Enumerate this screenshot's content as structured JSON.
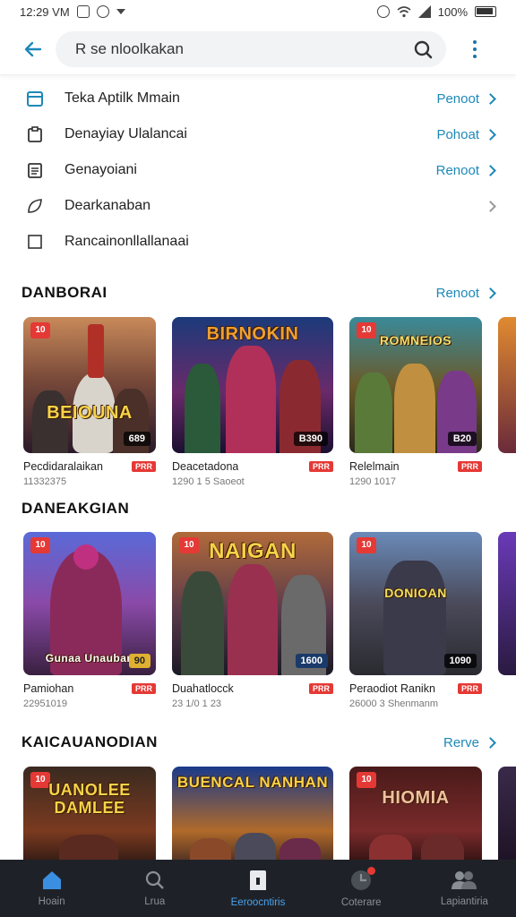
{
  "status": {
    "time": "12:29 VM",
    "battery": "100%"
  },
  "search": {
    "value": "R se nloolkakan"
  },
  "categories": [
    {
      "label": "Teka Aptilk Mmain",
      "action": "Penoot",
      "icon": "calendar-icon"
    },
    {
      "label": "Denayiay Ulalancai",
      "action": "Pohoat",
      "icon": "clipboard-icon"
    },
    {
      "label": "Genayoiani",
      "action": "Renoot",
      "icon": "document-icon"
    },
    {
      "label": "Dearkanaban",
      "action": "",
      "icon": "leaf-icon"
    },
    {
      "label": "Rancainonllallanaai",
      "action": "",
      "icon": "square-icon"
    }
  ],
  "sections": [
    {
      "title": "DANBORAI",
      "more": "Renoot",
      "cards": [
        {
          "art": "BEIOUNA",
          "price": "689",
          "name": "Pecdidaralaikan",
          "tag": "PRR",
          "sub": "11332375",
          "badge": "10"
        },
        {
          "art": "BIRNOKIN",
          "price": "B390",
          "name": "Deacetadona",
          "tag": "PRR",
          "sub": "1290 1 5 Saoeot",
          "badge": ""
        },
        {
          "art": "ROMNEIOS",
          "price": "B20",
          "name": "Relelmain",
          "tag": "PRR",
          "sub": "1290 1017",
          "badge": "10"
        }
      ]
    },
    {
      "title": "DANEAKGIAN",
      "more": "",
      "cards": [
        {
          "art": "Gunaa Unauban",
          "price": "90",
          "name": "Pamiohan",
          "tag": "PRR",
          "sub": "22951019",
          "badge": "10"
        },
        {
          "art": "NAIGAN",
          "price": "1600",
          "name": "Duahatlocck",
          "tag": "PRR",
          "sub": "23 1/0 1 23",
          "badge": "10"
        },
        {
          "art": "DONIOAN",
          "price": "1090",
          "name": "Peraodiot Ranikn",
          "tag": "PRR",
          "sub": "26000 3 Shenmanm",
          "badge": "10"
        }
      ]
    },
    {
      "title": "KAICAUANODIAN",
      "more": "Rerve",
      "cards": [
        {
          "art": "UANOLEE DAMLEE",
          "price": "",
          "name": "",
          "tag": "",
          "sub": "",
          "badge": "10"
        },
        {
          "art": "BUENCAL NANHAN",
          "price": "",
          "name": "",
          "tag": "",
          "sub": "",
          "badge": ""
        },
        {
          "art": "HIOMIA",
          "price": "",
          "name": "",
          "tag": "",
          "sub": "",
          "badge": "10"
        }
      ]
    }
  ],
  "nav": [
    {
      "label": "Hoain",
      "icon": "home-icon"
    },
    {
      "label": "Lrua",
      "icon": "search-icon"
    },
    {
      "label": "Eeroocntiris",
      "icon": "bookmark-icon"
    },
    {
      "label": "Coterare",
      "icon": "apps-icon"
    },
    {
      "label": "Lapiantiria",
      "icon": "people-icon"
    }
  ],
  "colors": {
    "accent": "#1e88b8",
    "nav_bg": "#1e2228",
    "nav_active": "#4aa3f0",
    "tag_red": "#e53935"
  }
}
